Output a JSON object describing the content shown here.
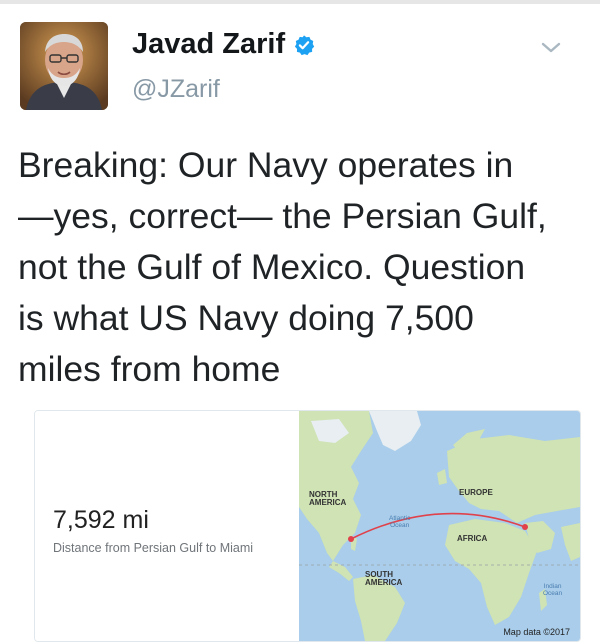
{
  "tweet": {
    "author": {
      "display_name": "Javad Zarif",
      "handle": "@JZarif",
      "verified": true,
      "verified_color": "#1da1f2"
    },
    "menu_icon": "chevron-down-icon",
    "text_lines": [
      "Breaking: Our Navy operates in",
      "—yes, correct— the Persian Gulf,",
      "not the Gulf of Mexico. Question",
      "is what US Navy doing 7,500",
      "miles from home"
    ]
  },
  "card": {
    "distance": "7,592 mi",
    "caption": "Distance from Persian Gulf to Miami",
    "map": {
      "labels": {
        "north_america": [
          "NORTH",
          "AMERICA"
        ],
        "europe": "EUROPE",
        "africa": "AFRICA",
        "south_america": [
          "SOUTH",
          "AMERICA"
        ],
        "atlantic": [
          "Atlantic",
          "Ocean"
        ],
        "indian": [
          "Indian",
          "Ocean"
        ]
      },
      "credit": "Map data ©2017",
      "route_color": "#e0414a",
      "water_color": "#a9cdea",
      "land_color": "#cfe3b4"
    }
  }
}
